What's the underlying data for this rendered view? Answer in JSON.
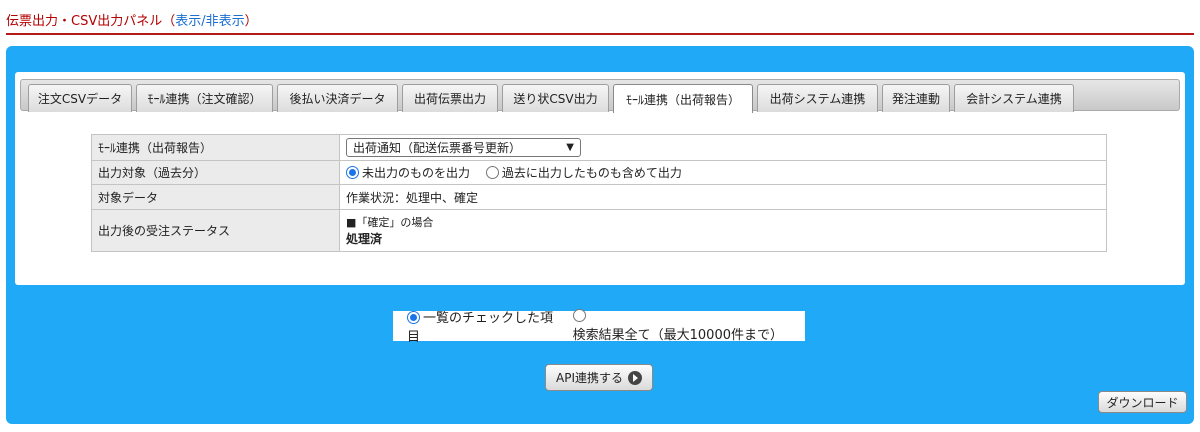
{
  "header": {
    "title": "伝票出力・CSV出力パネル",
    "paren_open": "（",
    "toggle_label": "表示/非表示",
    "paren_close": "）"
  },
  "tabs": [
    {
      "label": "注文CSVデータ"
    },
    {
      "label": "ﾓｰﾙ連携（注文確認）"
    },
    {
      "label": "後払い決済データ"
    },
    {
      "label": "出荷伝票出力"
    },
    {
      "label": "送り状CSV出力"
    },
    {
      "label": "ﾓｰﾙ連携（出荷報告）",
      "active": true
    },
    {
      "label": "出荷システム連携"
    },
    {
      "label": "発注連動"
    },
    {
      "label": "会計システム連携"
    }
  ],
  "settings": {
    "mall_link_label": "ﾓｰﾙ連携（出荷報告）",
    "mall_link_value": "出荷通知（配送伝票番号更新）",
    "target_label": "出力対象（過去分）",
    "target_opt1": "未出力のものを出力",
    "target_opt2": "過去に出力したものも含めて出力",
    "data_label": "対象データ",
    "data_value": "作業状況：処理中、確定",
    "status_label": "出力後の受注ステータス",
    "status_note": "■「確定」の場合",
    "status_value": "処理済"
  },
  "scope": {
    "opt1": "一覧のチェックした項目",
    "opt2": "検索結果全て（最大10000件まで）"
  },
  "buttons": {
    "api": "API連携する",
    "download": "ダウンロード"
  },
  "colors": {
    "panel_blue": "#1fa9f7",
    "header_red": "#b30000",
    "link_blue": "#1a6fd1"
  },
  "icons": {
    "select_arrow": "chevron-down-icon",
    "api_go": "arrow-circle-right-icon"
  }
}
